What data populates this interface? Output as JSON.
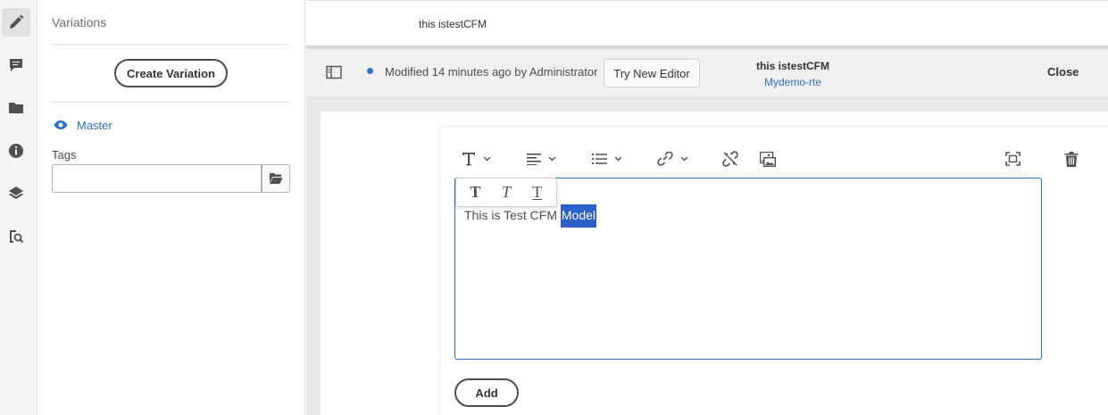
{
  "rail": {
    "icons": [
      "edit-icon",
      "comment-icon",
      "folder-icon",
      "info-icon",
      "layers-icon",
      "search-references-icon"
    ]
  },
  "panel": {
    "title": "Variations",
    "create_variation_label": "Create Variation",
    "master_label": "Master",
    "tags_label": "Tags",
    "tags_value": ""
  },
  "tabs": [
    {
      "label": "this istestCFM",
      "active": true
    }
  ],
  "actionbar": {
    "status_text": "Modified 14 minutes ago by Administrator",
    "try_new_editor_label": "Try New Editor",
    "doc_title": "this istestCFM",
    "doc_model": "Mydemo-rte",
    "close_label": "Close"
  },
  "rte": {
    "toolbar": [
      "text-format-icon",
      "align-icon",
      "list-icon",
      "link-icon",
      "unlink-icon",
      "image-icon",
      "fullscreen-icon",
      "delete-icon"
    ],
    "popover": [
      "T",
      "T",
      "T"
    ],
    "text_before": "This is Test CFM ",
    "text_selected": "Model",
    "add_label": "Add"
  },
  "colors": {
    "accent": "#2c71c6",
    "selection": "#2c60c9",
    "rail_bg": "#f4f4f4",
    "actionbar_bg": "#f0f0f0"
  }
}
